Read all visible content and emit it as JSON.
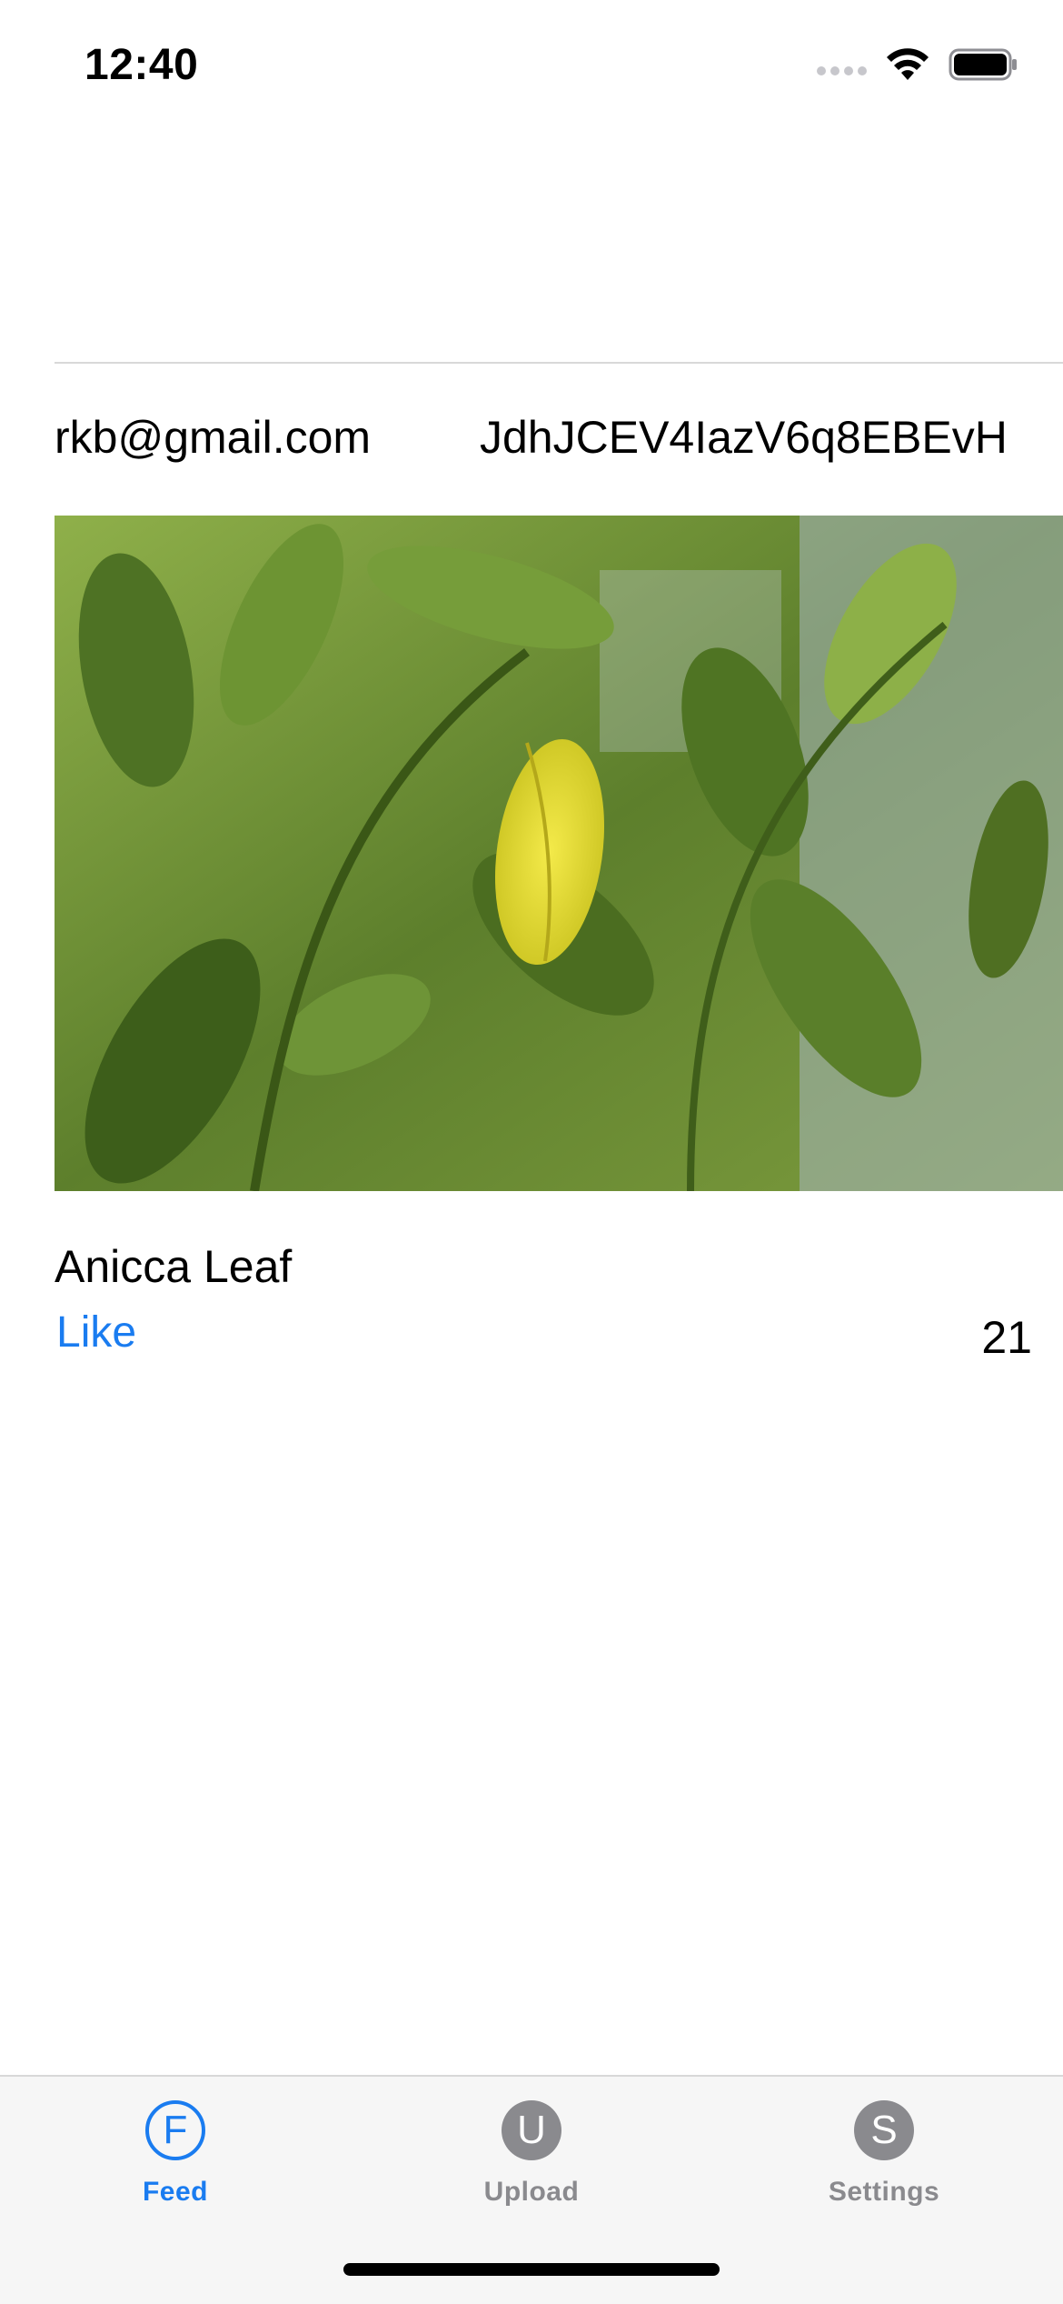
{
  "status_bar": {
    "time": "12:40",
    "icons": [
      "signal-icon",
      "wifi-icon",
      "battery-icon"
    ]
  },
  "post": {
    "email": "rkb@gmail.com",
    "post_id": "JdhJCEV4IazV6q8EBEvH",
    "image": "green-leaves-with-yellow-leaf-photo",
    "caption": "Anicca Leaf",
    "like_label": "Like",
    "like_count": "21"
  },
  "tab_bar": {
    "tabs": [
      {
        "letter": "F",
        "label": "Feed",
        "active": true
      },
      {
        "letter": "U",
        "label": "Upload",
        "active": false
      },
      {
        "letter": "S",
        "label": "Settings",
        "active": false
      }
    ]
  },
  "colors": {
    "accent": "#1a7cf0",
    "inactive": "#8a8a8e",
    "tab_bar_bg": "#f6f6f6"
  }
}
